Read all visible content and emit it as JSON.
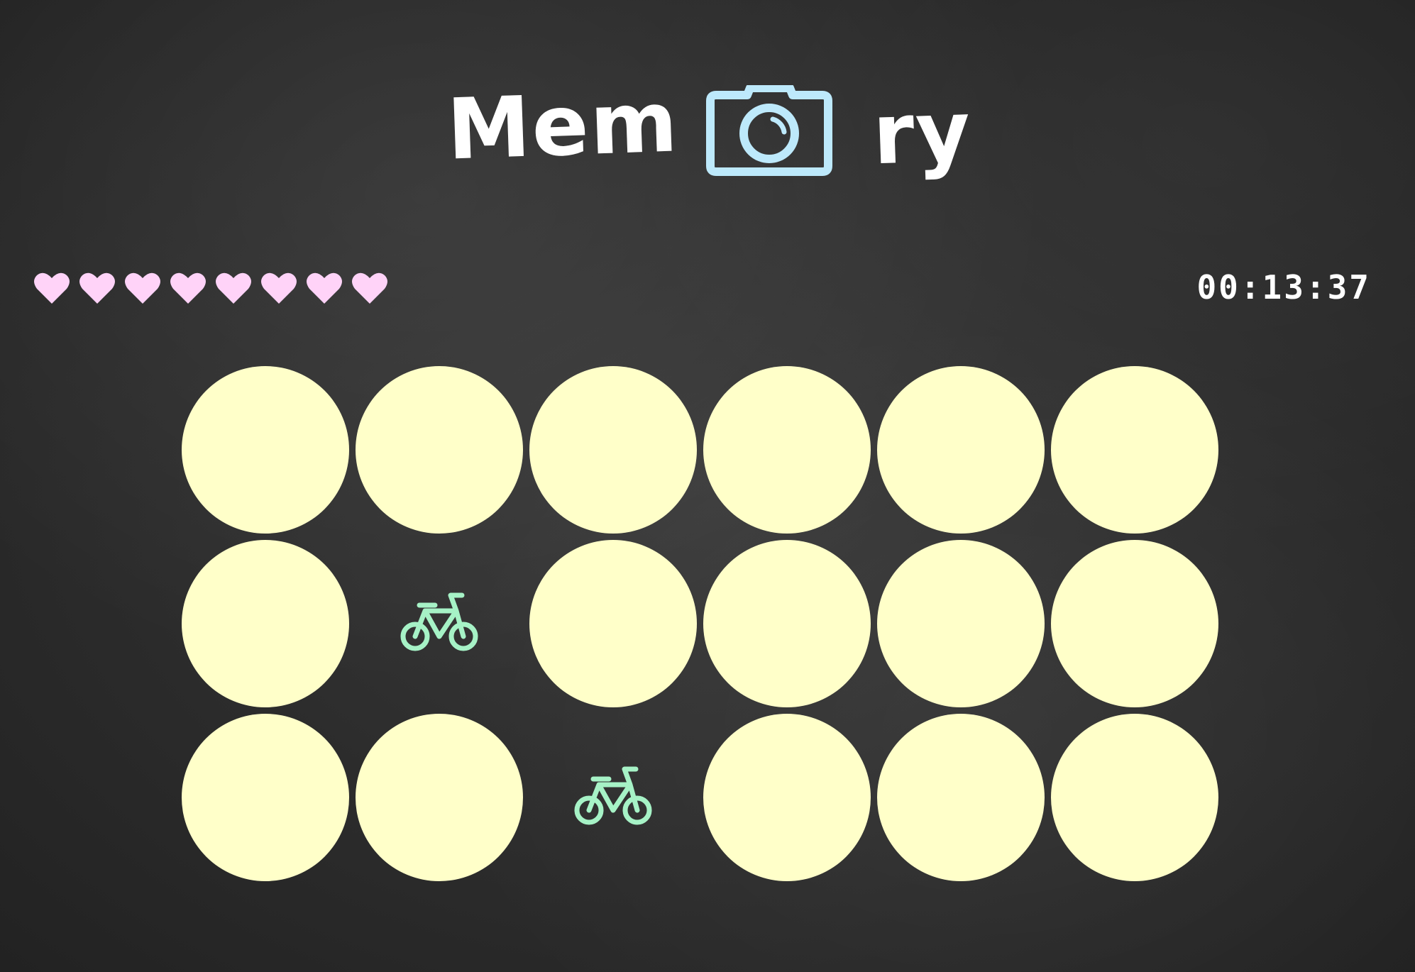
{
  "title": {
    "prefix": "Mem",
    "suffix": "ry",
    "camera_icon": "camera-icon",
    "text_color": "#ffffff",
    "camera_color": "#bde9fb"
  },
  "status": {
    "lives": 8,
    "heart_icon": "heart-icon",
    "heart_color": "#ffd3f8",
    "timer": "00:13:37"
  },
  "board": {
    "rows": 3,
    "columns": 6,
    "card_back_color": "#ffffc9",
    "symbol_color": "#a6f2c6",
    "cards": [
      {
        "state": "face-down",
        "symbol": ""
      },
      {
        "state": "face-down",
        "symbol": ""
      },
      {
        "state": "face-down",
        "symbol": ""
      },
      {
        "state": "face-down",
        "symbol": ""
      },
      {
        "state": "face-down",
        "symbol": ""
      },
      {
        "state": "face-down",
        "symbol": ""
      },
      {
        "state": "face-down",
        "symbol": ""
      },
      {
        "state": "face-up",
        "symbol": "bicycle-icon"
      },
      {
        "state": "face-down",
        "symbol": ""
      },
      {
        "state": "face-down",
        "symbol": ""
      },
      {
        "state": "face-down",
        "symbol": ""
      },
      {
        "state": "face-down",
        "symbol": ""
      },
      {
        "state": "face-down",
        "symbol": ""
      },
      {
        "state": "face-down",
        "symbol": ""
      },
      {
        "state": "face-up",
        "symbol": "bicycle-icon"
      },
      {
        "state": "face-down",
        "symbol": ""
      },
      {
        "state": "face-down",
        "symbol": ""
      },
      {
        "state": "face-down",
        "symbol": ""
      }
    ]
  }
}
